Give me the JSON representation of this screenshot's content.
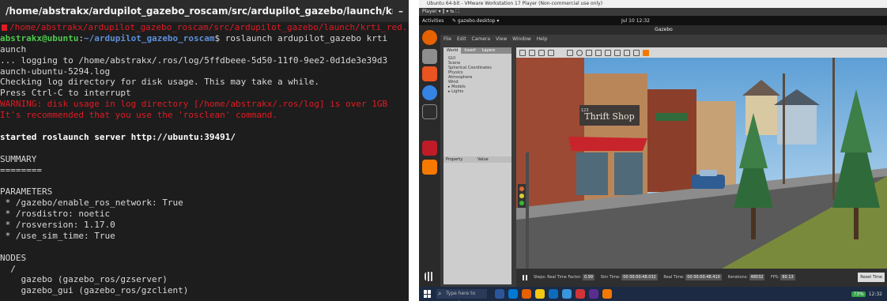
{
  "terminal": {
    "title": "/home/abstrakx/ardupilot_gazebo_roscam/src/ardupilot_gazebo/launch/krti_red.laun...",
    "minimize_glyph": "–",
    "tab_path": "/home/abstrakx/ardupilot_gazebo_roscam/src/ardupilot_gazebo/launch/krti_red.launch http:/",
    "prompt_user": "abstrakx@ubuntu",
    "prompt_sep": ":",
    "prompt_dir": "~/ardupilot_gazebo_roscam",
    "prompt_cmd": "$ roslaunch ardupilot_gazebo krti",
    "lines": {
      "l3": "aunch",
      "l4": "... logging to /home/abstrakx/.ros/log/5ffdbeee-5d50-11f0-9ee2-0d1de3e39d3",
      "l5": "aunch-ubuntu-5294.log",
      "l6": "Checking log directory for disk usage. This may take a while.",
      "l7": "Press Ctrl-C to interrupt",
      "l8": "WARNING: disk usage in log directory [/home/abstrakx/.ros/log] is over 1GB",
      "l9": "It's recommended that you use the 'rosclean' command.",
      "l11": "started roslaunch server http://ubuntu:39491/",
      "l13": "SUMMARY",
      "l14": "========",
      "l16": "PARAMETERS",
      "l17": " * /gazebo/enable_ros_network: True",
      "l18": " * /rosdistro: noetic",
      "l19": " * /rosversion: 1.17.0",
      "l20": " * /use_sim_time: True",
      "l22": "NODES",
      "l23": "  /",
      "l24": "    gazebo (gazebo_ros/gzserver)",
      "l25": "    gazebo_gui (gazebo_ros/gzclient)"
    }
  },
  "vm": {
    "window_title": "Ubuntu 64-bit - VMware Workstation 17 Player (Non-commercial use only)",
    "menu": "Player ▾  ‖ ▾  ⇆  ⛶",
    "topbar": {
      "activities": "Activities",
      "app": "✎ gazebo.desktop ▾",
      "clock": "Jul 10  12:32"
    },
    "gazebo": {
      "title": "Gazebo",
      "menu": [
        "File",
        "Edit",
        "Camera",
        "View",
        "Window",
        "Help"
      ],
      "tabs": [
        "World",
        "Insert",
        "Layers"
      ],
      "tree": [
        "GUI",
        "Scene",
        "Spherical Coordinates",
        "Physics",
        "Atmosphere",
        "Wind",
        "▸ Models",
        "▸ Lights"
      ],
      "props_header": [
        "Property",
        "Value"
      ],
      "scene_sign": "Thrift Shop",
      "scene_number": "123",
      "bottom": {
        "steps_label": "Steps:",
        "rtf_label": "Real Time Factor:",
        "rtf_value": "0.99",
        "sim_label": "Sim Time:",
        "sim_value": "00 00:00:48.032",
        "real_label": "Real Time:",
        "real_value": "00 00:00:48.410",
        "iter_label": "Iterations:",
        "iter_value": "48032",
        "fps_label": "FPS:",
        "fps_value": "60.13",
        "reset": "Reset Time"
      }
    },
    "taskbar": {
      "search_placeholder": "Type here to search",
      "tray_battery": "73%",
      "tray_time": "12:32"
    }
  }
}
